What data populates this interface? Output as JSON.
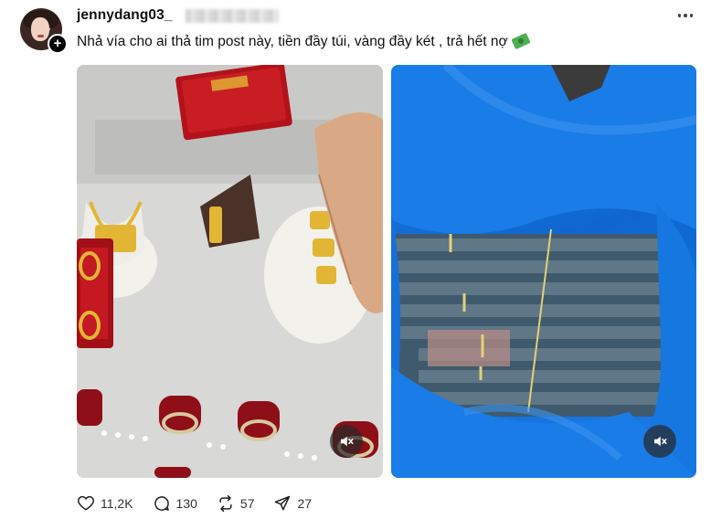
{
  "post": {
    "username": "jennydang03_",
    "caption": "Nhả vía cho ai thả tim post này, tiền đầy túi, vàng đầy két , trả hết nợ",
    "caption_emoji": "money-with-wings-icon"
  },
  "actions": {
    "likes": "11,2K",
    "comments": "130",
    "reposts": "57",
    "shares": "27"
  },
  "colors": {
    "text": "#101010",
    "bag_blue": "#1273dc",
    "box_red": "#b3121b",
    "gold": "#e2b634"
  }
}
